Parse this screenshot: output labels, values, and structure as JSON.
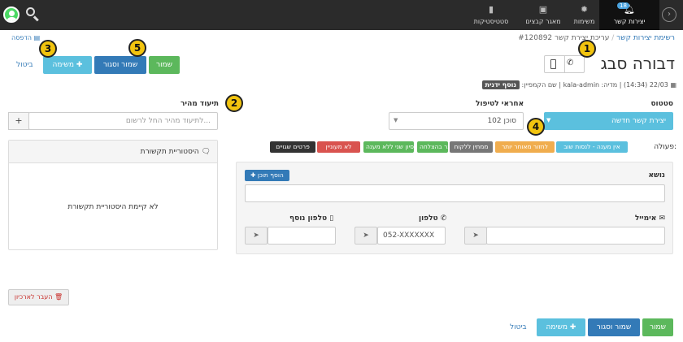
{
  "nav": {
    "leads_label": "יצירות קשר",
    "leads_badge": "18",
    "tasks_label": "משימות",
    "files_label": "מאגר קבצים",
    "stats_label": "סטטיסטיקות"
  },
  "breadcrumb": {
    "list": "רשימת יצירות קשר",
    "current": "עריכת יצירת קשר #120892"
  },
  "print_label": "הדפסה",
  "lead": {
    "name": "דבורה סבג",
    "meta_prefix": "22/03 (14:34) | מדיה: kala-admin | שם הקמפיין:",
    "add_field": "נוסף ידנית"
  },
  "actions": {
    "save": "שמור",
    "save_close": "שמור וסגור",
    "task": "משימה",
    "cancel": "ביטול"
  },
  "status": {
    "label": "סטטוס",
    "value": "יצירת קשר חדשה"
  },
  "agent": {
    "label": "אחראי לטיפול",
    "value": "סוכן 102"
  },
  "quick_doc": {
    "label": "תיעוד מהיר",
    "placeholder": "לתיעוד מהיר החל לרשום..."
  },
  "history": {
    "title": "היסטוריית תקשורת",
    "empty": "לא קיימת היסטוריית תקשורת"
  },
  "action_label": "פעולה:",
  "tags": [
    "אין מענה - לנסות שוב",
    "לחזור מאוחר יותר",
    "ממתין ללקוח",
    "נסגר בהצלחה",
    "נסיון שני ללא מענה",
    "לא מעוניין",
    "פרטים שגויים"
  ],
  "tag_colors": [
    "#5bc0de",
    "#f0ad4e",
    "#777777",
    "#5cb85c",
    "#5cb85c",
    "#d9534f",
    "#333333"
  ],
  "subject": {
    "label": "נושא",
    "add_content": "הוסף תוכן"
  },
  "email": {
    "label": "אימייל",
    "value": ""
  },
  "phone": {
    "label": "טלפון",
    "value": "052-XXXXXXX"
  },
  "phone2": {
    "label": "טלפון נוסף",
    "value": ""
  },
  "archive": "העבר לארכיון",
  "markers": [
    "1",
    "2",
    "3",
    "4",
    "5"
  ]
}
